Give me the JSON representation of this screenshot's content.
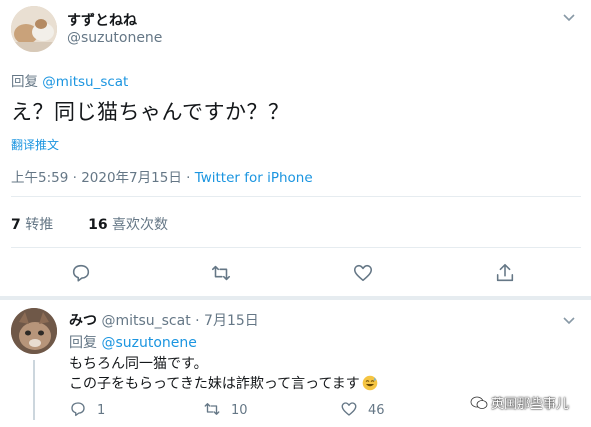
{
  "main_tweet": {
    "display_name": "すずとねね",
    "handle": "@suzutonene",
    "reply_prefix": "回复",
    "reply_to": "@mitsu_scat",
    "text": "え？同じ猫ちゃんですか？？",
    "translate": "翻译推文",
    "time": "上午5:59 · 2020年7月15日 · ",
    "source": "Twitter for iPhone",
    "retweet_count": "7",
    "retweet_label": "转推",
    "like_count": "16",
    "like_label": "喜欢次数"
  },
  "reply_tweet": {
    "display_name": "みつ",
    "handle": "@mitsu_scat",
    "date": "· 7月15日",
    "reply_prefix": "回复",
    "reply_to": "@suzutonene",
    "text_line1": "もちろん同一猫です。",
    "text_line2": "この子をもらってきた妹は詐欺って言ってます",
    "reply_count": "1",
    "retweet_count": "10",
    "like_count": "46"
  },
  "watermark": "英国那些事儿",
  "icons": {
    "reply": "reply-icon",
    "retweet": "retweet-icon",
    "like": "heart-icon",
    "share": "share-icon",
    "more": "chevron-down-icon",
    "emoji": "sweat-smile-emoji"
  },
  "colors": {
    "link": "#1b95e0",
    "muted": "#657786",
    "text": "#14171a",
    "divider": "#e6ecf0"
  }
}
